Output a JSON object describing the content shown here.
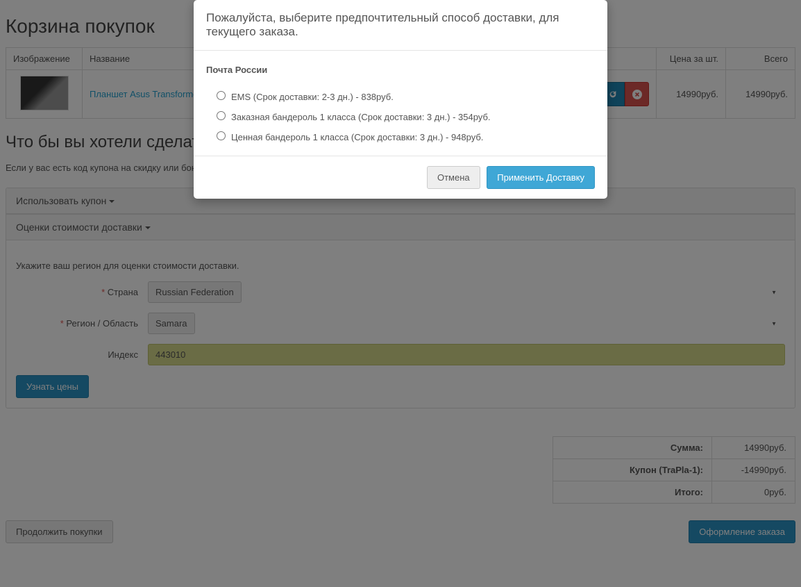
{
  "page": {
    "title": "Корзина покупок",
    "section_title": "Что бы вы хотели сделать",
    "hint": "Если у вас есть код купона на скидку или бонус ... вы можете приблизительно узнать стоимость доставки в ваш регион."
  },
  "cart_table": {
    "headers": {
      "image": "Изображение",
      "name": "Название",
      "price": "Цена за шт.",
      "total": "Всего"
    },
    "rows": [
      {
        "name": "Планшет Asus Transformer",
        "price": "14990руб.",
        "total": "14990руб."
      }
    ]
  },
  "accordion": {
    "coupon_title": "Использовать купон",
    "shipping_title": "Оценки стоимости доставки",
    "shipping_hint": "Укажите ваш регион для оценки стоимости доставки.",
    "labels": {
      "country": "Страна",
      "region": "Регион / Область",
      "postcode": "Индекс"
    },
    "values": {
      "country": "Russian Federation",
      "region": "Samara",
      "postcode": "443010"
    },
    "get_quotes_btn": "Узнать цены"
  },
  "totals": {
    "rows": [
      {
        "label": "Сумма:",
        "value": "14990руб."
      },
      {
        "label": "Купон (TraPla-1):",
        "value": "-14990руб."
      },
      {
        "label": "Итого:",
        "value": "0руб."
      }
    ]
  },
  "footer": {
    "continue_shopping": "Продолжить покупки",
    "checkout": "Оформление заказа"
  },
  "modal": {
    "title": "Пожалуйста, выберите предпочтительный способ доставки, для текущего заказа.",
    "group": "Почта России",
    "options": [
      "EMS (Срок доставки: 2-3 дн.) - 838руб.",
      "Заказная бандероль 1 класса (Срок доставки: 3 дн.) - 354руб.",
      "Ценная бандероль 1 класса (Срок доставки: 3 дн.) - 948руб."
    ],
    "cancel": "Отмена",
    "apply": "Применить Доставку"
  }
}
